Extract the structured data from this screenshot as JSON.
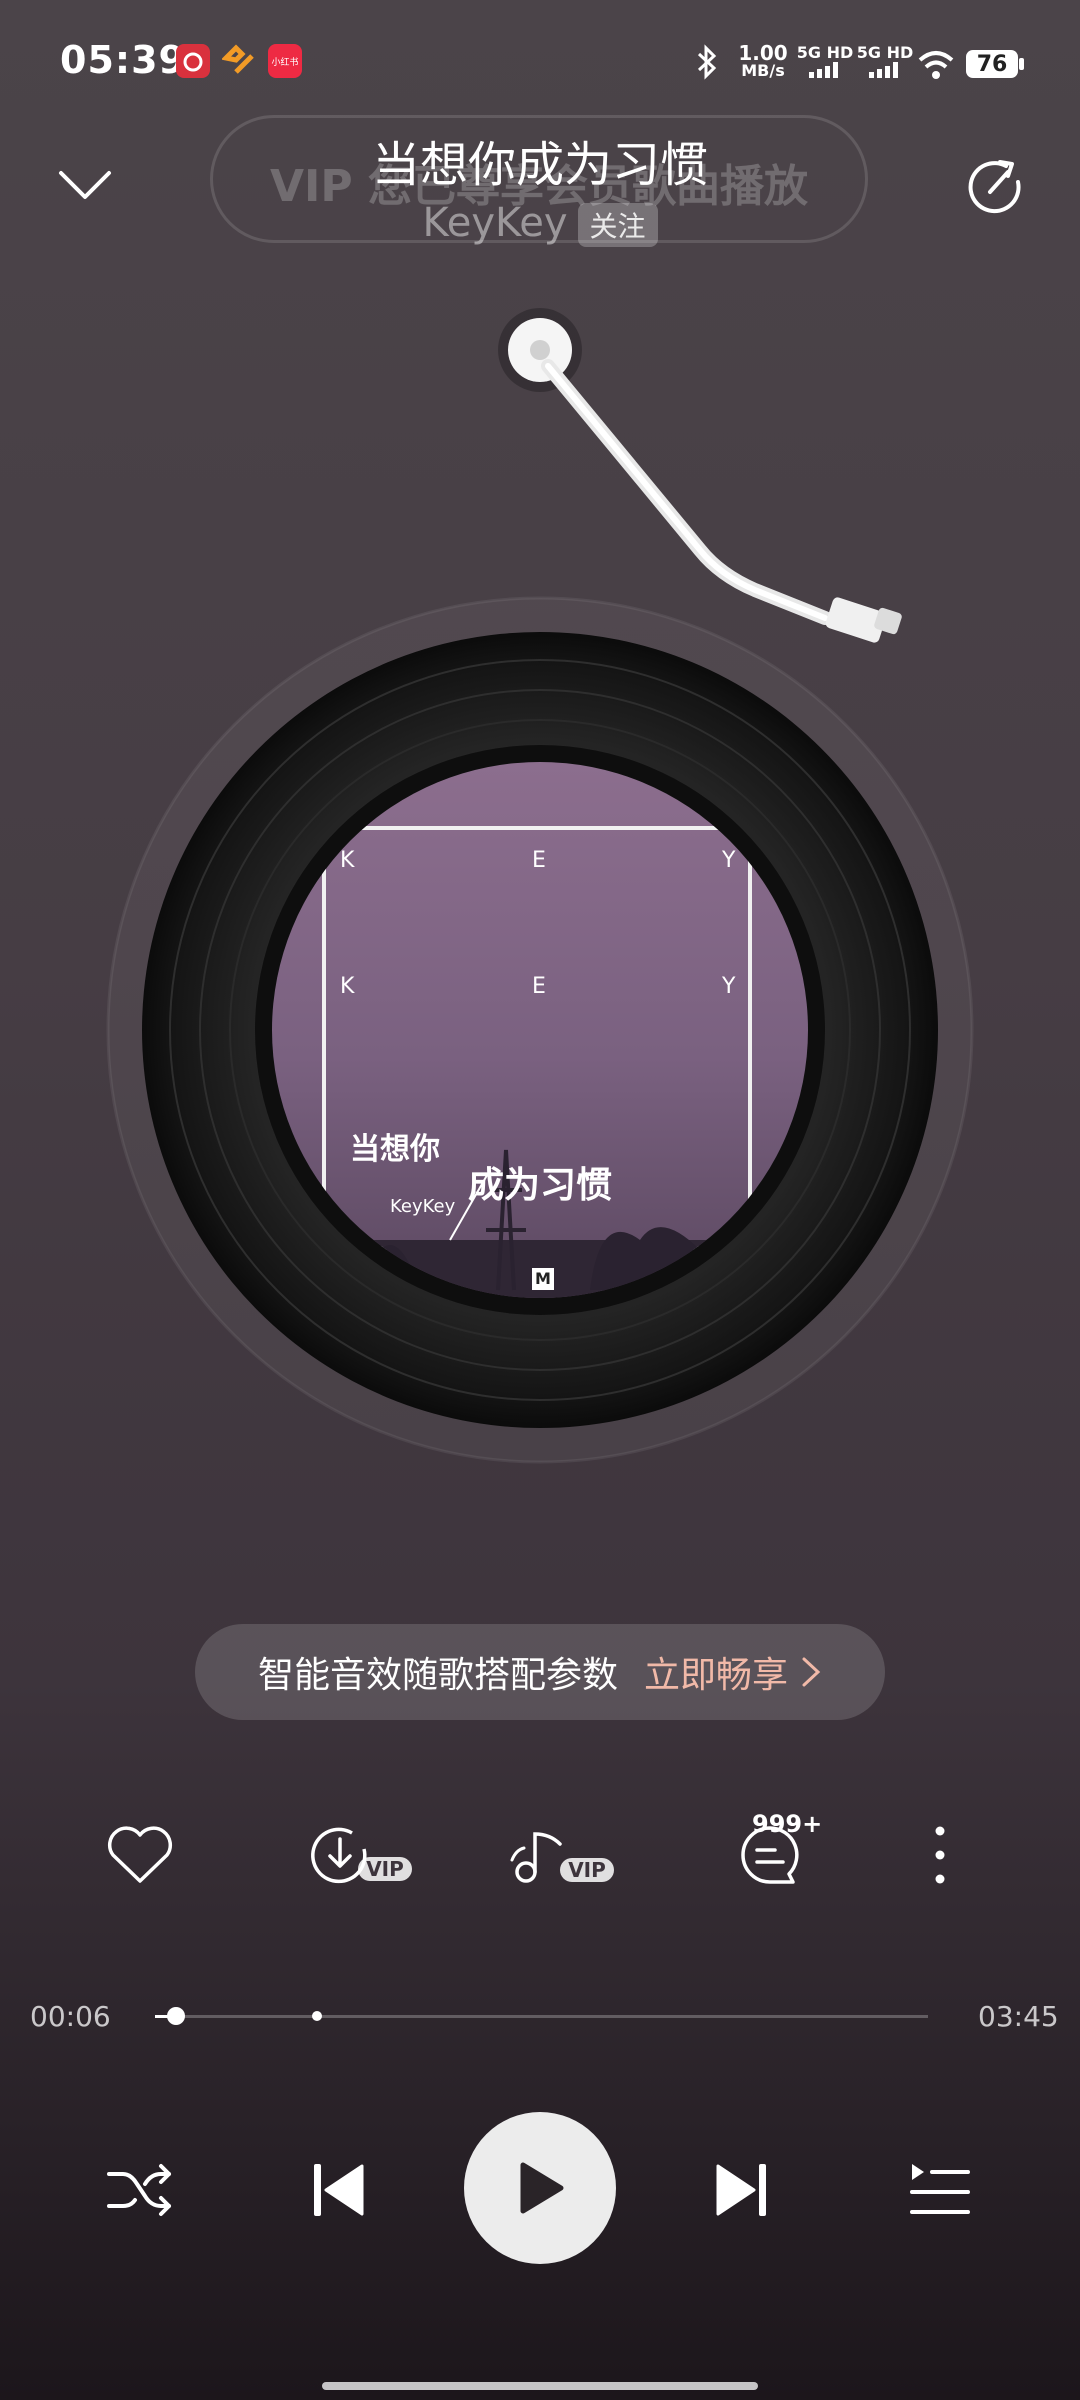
{
  "status_bar": {
    "time": "05:39",
    "net_speed_value": "1.00",
    "net_speed_unit": "MB/s",
    "sim1": "5G HD",
    "sim2": "5G HD",
    "battery": "76",
    "app_icons": [
      "netease-music-icon",
      "app-orange-icon",
      "xiaohongshu-icon"
    ],
    "app_icon_label": "小红书"
  },
  "header": {
    "title": "当想你成为习惯",
    "banner_text": "VIP 您已尊享会员歌曲播放",
    "artist": "KeyKey",
    "follow_label": "关注"
  },
  "cover": {
    "letters_row1": [
      "K",
      "E",
      "Y"
    ],
    "letters_row2": [
      "K",
      "E",
      "Y"
    ],
    "title_part1": "当想你",
    "title_part2": "成为习惯",
    "artist": "KeyKey",
    "label_logo": "M"
  },
  "promo": {
    "text": "智能音效随歌搭配参数",
    "cta": "立即畅享"
  },
  "actions": {
    "download_badge": "VIP",
    "effect_badge": "VIP",
    "comment_count": "999+"
  },
  "progress": {
    "current": "00:06",
    "total": "03:45",
    "played_fraction": 0.027,
    "buffered_fraction": 0.21
  },
  "colors": {
    "accent_cta": "#f1b9a8",
    "background_top": "#4b4449",
    "background_bottom": "#1c161b"
  }
}
